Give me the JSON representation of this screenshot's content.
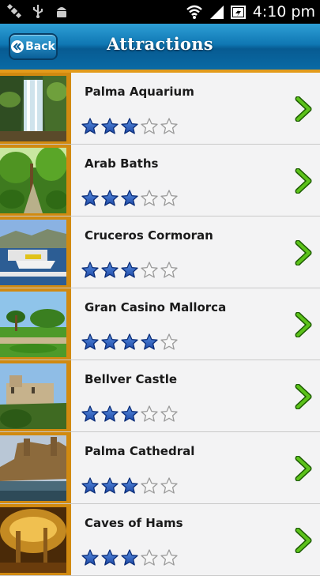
{
  "status_bar": {
    "left_icons": [
      "satellite-icon",
      "usb-icon",
      "android-icon"
    ],
    "right_icons": [
      "wifi-icon",
      "signal-icon",
      "battery-icon"
    ],
    "time": "4:10 pm"
  },
  "header": {
    "back_label": "Back",
    "title": "Attractions",
    "accent": "#e39b1b"
  },
  "attractions": [
    {
      "name": "Palma Aquarium",
      "rating": 3,
      "max": 5,
      "image": "waterfall"
    },
    {
      "name": "Arab Baths",
      "rating": 3,
      "max": 5,
      "image": "garden"
    },
    {
      "name": "Cruceros Cormoran",
      "rating": 3,
      "max": 5,
      "image": "harbor"
    },
    {
      "name": "Gran Casino Mallorca",
      "rating": 4,
      "max": 5,
      "image": "park"
    },
    {
      "name": "Bellver Castle",
      "rating": 3,
      "max": 5,
      "image": "castle"
    },
    {
      "name": "Palma Cathedral",
      "rating": 3,
      "max": 5,
      "image": "cathedral"
    },
    {
      "name": "Caves of Hams",
      "rating": 3,
      "max": 5,
      "image": "cave"
    }
  ]
}
